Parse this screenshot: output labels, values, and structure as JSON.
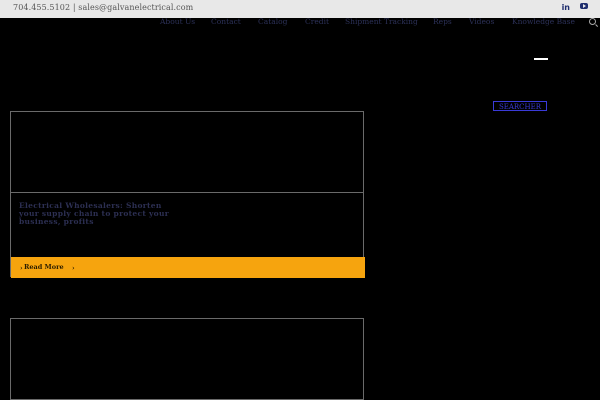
{
  "topbar": {
    "contact": "704.455.5102 | sales@galvanelectrical.com",
    "social": [
      "in"
    ]
  },
  "nav": {
    "items": [
      "About Us",
      "Contact",
      "Catalog",
      "Credit",
      "Shipment Tracking",
      "Reps",
      "Videos",
      "Knowledge Base"
    ]
  },
  "search": {
    "button_label": "SEARCHER"
  },
  "articles": [
    {
      "title": "Electrical Wholesalers: Shorten your supply chain to protect your business, profits",
      "readmore_label": "Read More"
    }
  ],
  "colors": {
    "accent": "#f6a40e",
    "nav_text": "#2c3158",
    "topbar_bg": "#e8e8e8",
    "search_border": "#3a3ad8"
  }
}
